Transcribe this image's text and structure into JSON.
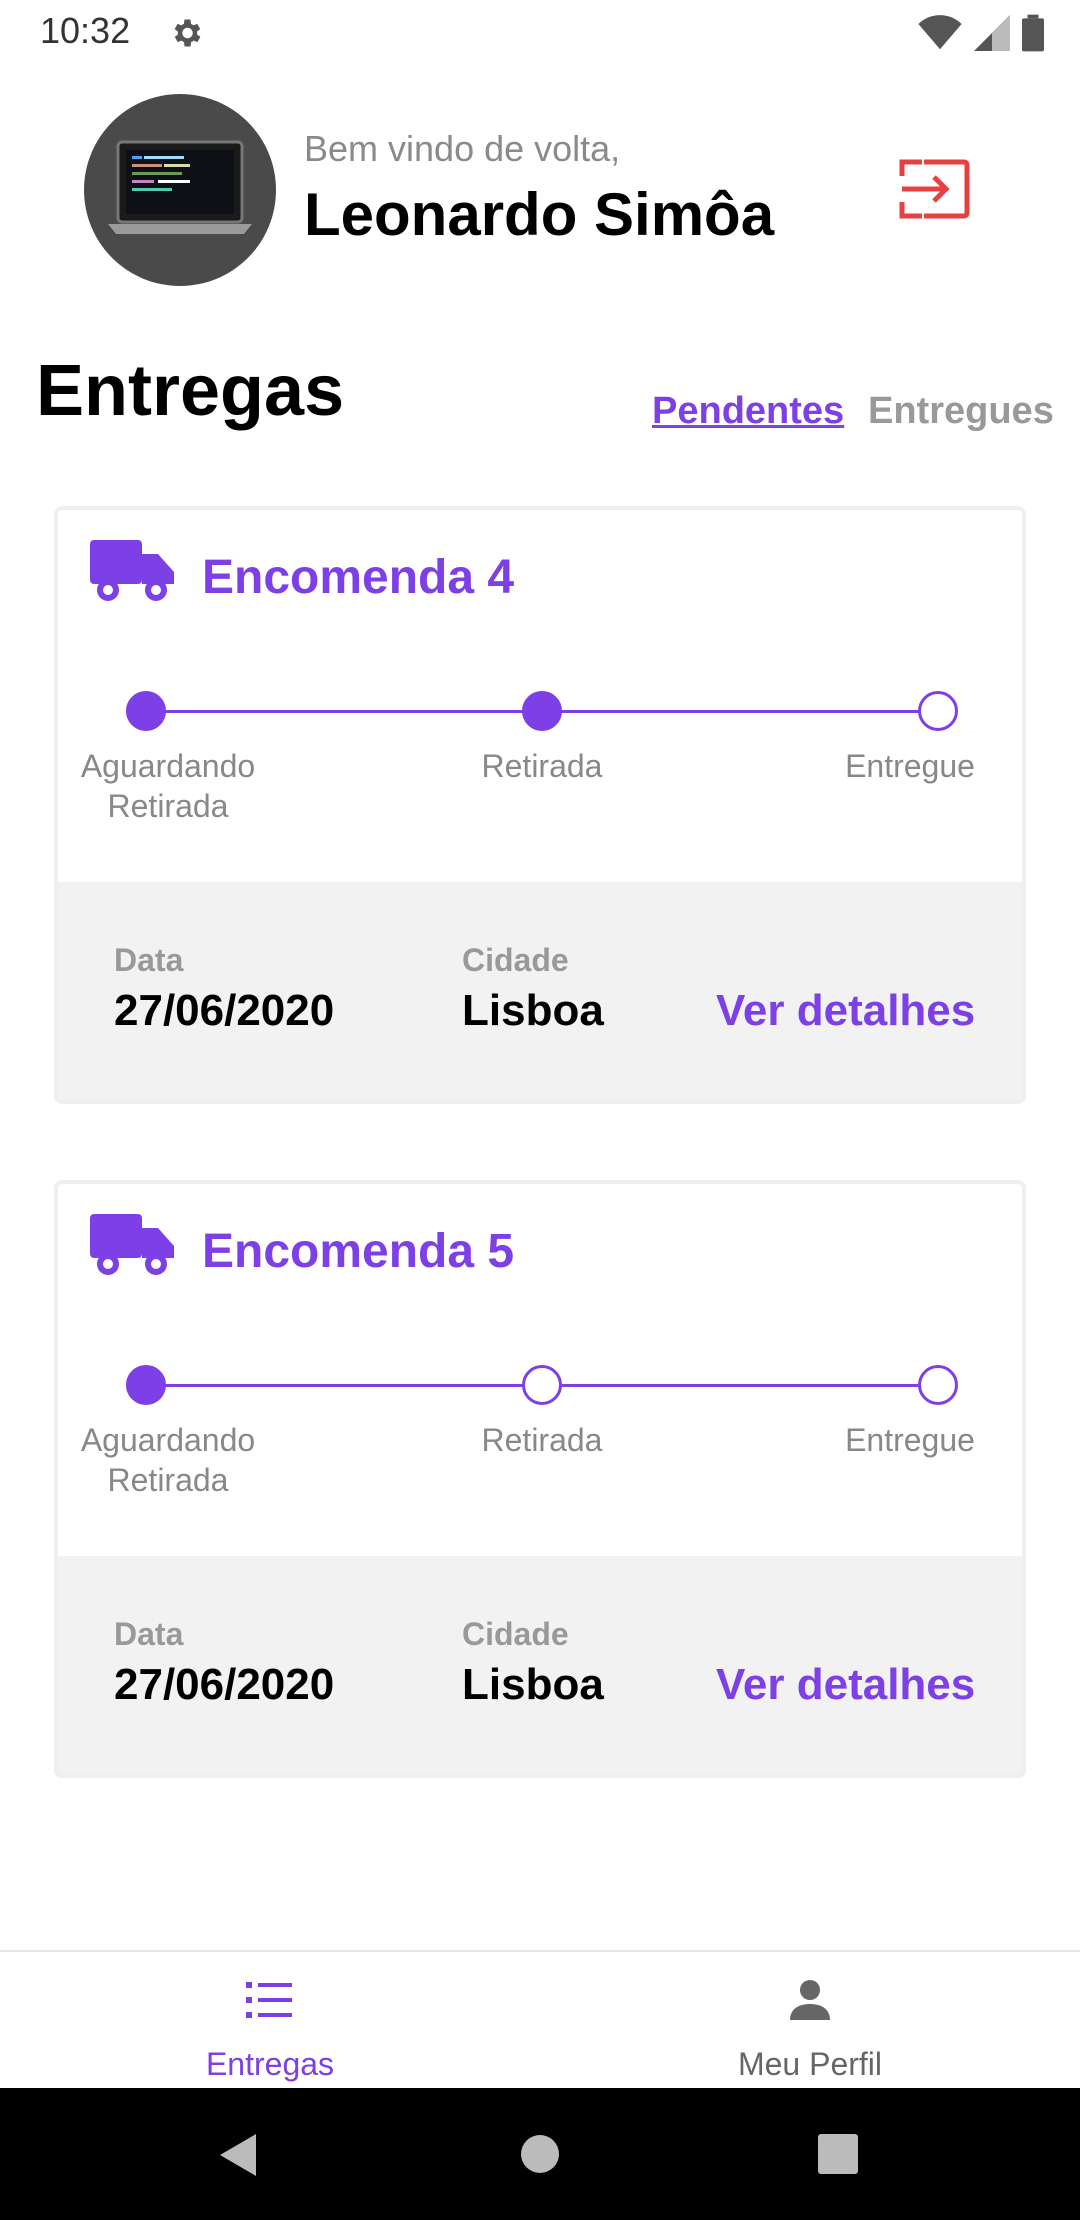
{
  "status_bar": {
    "time": "10:32",
    "icons": [
      "gear-icon",
      "wifi-icon",
      "signal-icon",
      "battery-icon"
    ]
  },
  "header": {
    "welcome": "Bem vindo de volta,",
    "name": "Leonardo Simôa",
    "logout_icon": "logout-icon",
    "logout_color": "#e74040"
  },
  "section": {
    "title": "Entregas",
    "tabs": [
      {
        "label": "Pendentes",
        "active": true
      },
      {
        "label": "Entregues",
        "active": false
      }
    ]
  },
  "deliveries": [
    {
      "title": "Encomenda 4",
      "steps": [
        "Aguardando Retirada",
        "Retirada",
        "Entregue"
      ],
      "completed_steps": 2,
      "date_label": "Data",
      "date": "27/06/2020",
      "city_label": "Cidade",
      "city": "Lisboa",
      "details_label": "Ver detalhes"
    },
    {
      "title": "Encomenda 5",
      "steps": [
        "Aguardando Retirada",
        "Retirada",
        "Entregue"
      ],
      "completed_steps": 1,
      "date_label": "Data",
      "date": "27/06/2020",
      "city_label": "Cidade",
      "city": "Lisboa",
      "details_label": "Ver detalhes"
    }
  ],
  "bottom_nav": [
    {
      "label": "Entregas",
      "icon": "list-icon",
      "active": true
    },
    {
      "label": "Meu Perfil",
      "icon": "person-icon",
      "active": false
    }
  ],
  "system_nav": [
    "back-icon",
    "home-icon",
    "recents-icon"
  ],
  "colors": {
    "accent": "#7d40e7",
    "inactive": "#999999",
    "card_footer": "#f2f2f2"
  }
}
